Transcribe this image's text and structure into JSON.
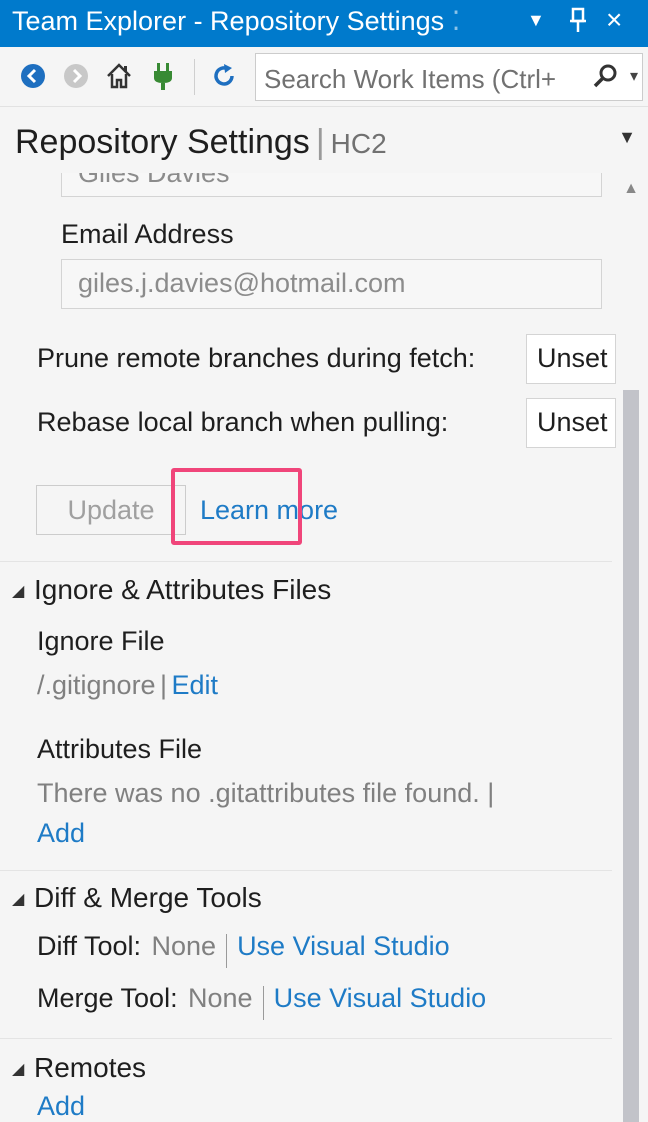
{
  "window": {
    "title": "Team Explorer - Repository Settings",
    "controls": [
      "▾",
      "pin",
      "×"
    ]
  },
  "toolbar": {
    "search_placeholder": "Search Work Items (Ctrl+"
  },
  "page": {
    "title": "Repository Settings",
    "context": "HC2"
  },
  "user": {
    "name_value": "Giles Davies",
    "email_label": "Email Address",
    "email_value": "giles.j.davies@hotmail.com"
  },
  "options": {
    "prune_label": "Prune remote branches during fetch:",
    "prune_value": "Unset",
    "rebase_label": "Rebase local branch when pulling:",
    "rebase_value": "Unset"
  },
  "actions": {
    "update_label": "Update",
    "learn_more_label": "Learn more"
  },
  "ignore_section": {
    "header": "Ignore & Attributes Files",
    "ignore_file_label": "Ignore File",
    "ignore_file_path": "/.gitignore",
    "separator": "|",
    "edit_label": "Edit",
    "attributes_file_label": "Attributes File",
    "attributes_message": "There was no .gitattributes file found. |",
    "add_label": "Add"
  },
  "diff_section": {
    "header": "Diff & Merge Tools",
    "diff_label": "Diff Tool:",
    "diff_value": "None",
    "diff_link": "Use Visual Studio",
    "merge_label": "Merge Tool:",
    "merge_value": "None",
    "merge_link": "Use Visual Studio"
  },
  "remotes_section": {
    "header": "Remotes",
    "add_label": "Add"
  },
  "colors": {
    "accent": "#007acc",
    "link": "#1e7bc6",
    "highlight": "#f0457a"
  }
}
